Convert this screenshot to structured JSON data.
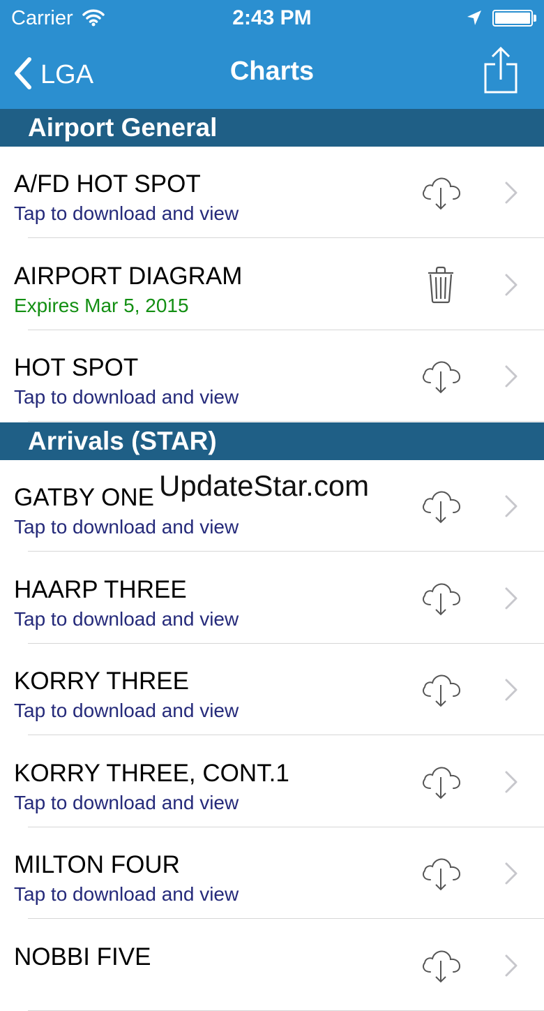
{
  "status_bar": {
    "carrier": "Carrier",
    "time": "2:43 PM",
    "wifi_icon": "wifi-icon",
    "location_icon": "location-arrow-icon",
    "battery_icon": "battery-icon"
  },
  "nav": {
    "back_label": "LGA",
    "title": "Charts",
    "share_icon": "share-icon"
  },
  "sections": [
    {
      "title": "Airport General",
      "rows": [
        {
          "title": "A/FD HOT SPOT",
          "subtitle": "Tap to download and view",
          "status": "download"
        },
        {
          "title": "AIRPORT DIAGRAM",
          "subtitle": "Expires Mar 5, 2015",
          "status": "downloaded"
        },
        {
          "title": "HOT SPOT",
          "subtitle": "Tap to download and view",
          "status": "download"
        }
      ]
    },
    {
      "title": "Arrivals (STAR)",
      "rows": [
        {
          "title": "GATBY ONE",
          "subtitle": "Tap to download and view",
          "status": "download"
        },
        {
          "title": "HAARP THREE",
          "subtitle": "Tap to download and view",
          "status": "download"
        },
        {
          "title": "KORRY THREE",
          "subtitle": "Tap to download and view",
          "status": "download"
        },
        {
          "title": "KORRY THREE, CONT.1",
          "subtitle": "Tap to download and view",
          "status": "download"
        },
        {
          "title": "MILTON FOUR",
          "subtitle": "Tap to download and view",
          "status": "download"
        },
        {
          "title": "NOBBI FIVE",
          "subtitle": "",
          "status": "download"
        }
      ]
    }
  ],
  "watermark": "UpdateStar.com",
  "colors": {
    "bar_blue": "#2b8fd0",
    "section_blue": "#1f5f86",
    "subtitle_blue": "#252a7a",
    "expires_green": "#138f13"
  }
}
